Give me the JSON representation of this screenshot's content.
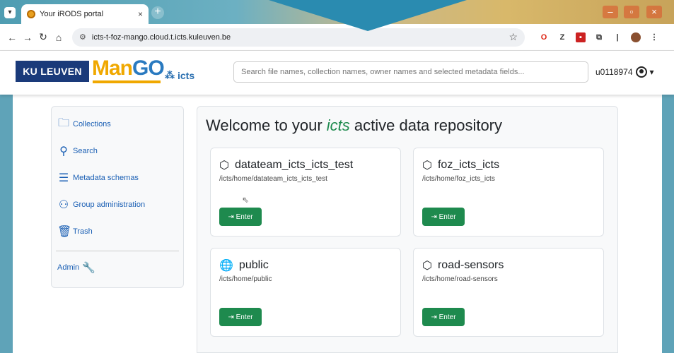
{
  "browser": {
    "tab_title": "Your iRODS portal",
    "tab_close": "×",
    "new_tab": "+",
    "url": "icts-t-foz-mango.cloud.t.icts.kuleuven.be",
    "window_minimize": "–",
    "window_restore": "▫",
    "window_close": "×"
  },
  "header": {
    "ku_logo_text": "KU LEUVEN",
    "mango_text_man": "Man",
    "mango_text_go": "GO",
    "zone_name": "icts",
    "search_placeholder": "Search file names, collection names, owner names and selected metadata fields...",
    "username": "u0118974",
    "user_caret": "▾"
  },
  "sidebar": {
    "items": [
      {
        "label": "Collections",
        "icon": "folder-icon"
      },
      {
        "label": "Search",
        "icon": "search-icon"
      },
      {
        "label": "Metadata schemas",
        "icon": "list-icon"
      },
      {
        "label": "Group administration",
        "icon": "people-icon"
      },
      {
        "label": "Trash",
        "icon": "trash-icon"
      }
    ],
    "admin_label": "Admin"
  },
  "main": {
    "welcome_prefix": "Welcome to your ",
    "welcome_zone": "icts",
    "welcome_suffix": " active data repository",
    "cards": [
      {
        "title": "datateam_icts_icts_test",
        "path": "/icts/home/datateam_icts_icts_test",
        "icon": "cube-icon",
        "button": "⇥ Enter"
      },
      {
        "title": "foz_icts_icts",
        "path": "/icts/home/foz_icts_icts",
        "icon": "cube-icon",
        "button": "⇥ Enter"
      },
      {
        "title": "public",
        "path": "/icts/home/public",
        "icon": "globe-icon",
        "button": "⇥ Enter"
      },
      {
        "title": "road-sensors",
        "path": "/icts/home/road-sensors",
        "icon": "cube-icon",
        "button": "⇥ Enter"
      }
    ]
  },
  "colors": {
    "accent_green": "#1e8a4e",
    "link_blue": "#1a5fb4",
    "ku_blue": "#1a3a7a",
    "mango_orange": "#f0a800"
  }
}
